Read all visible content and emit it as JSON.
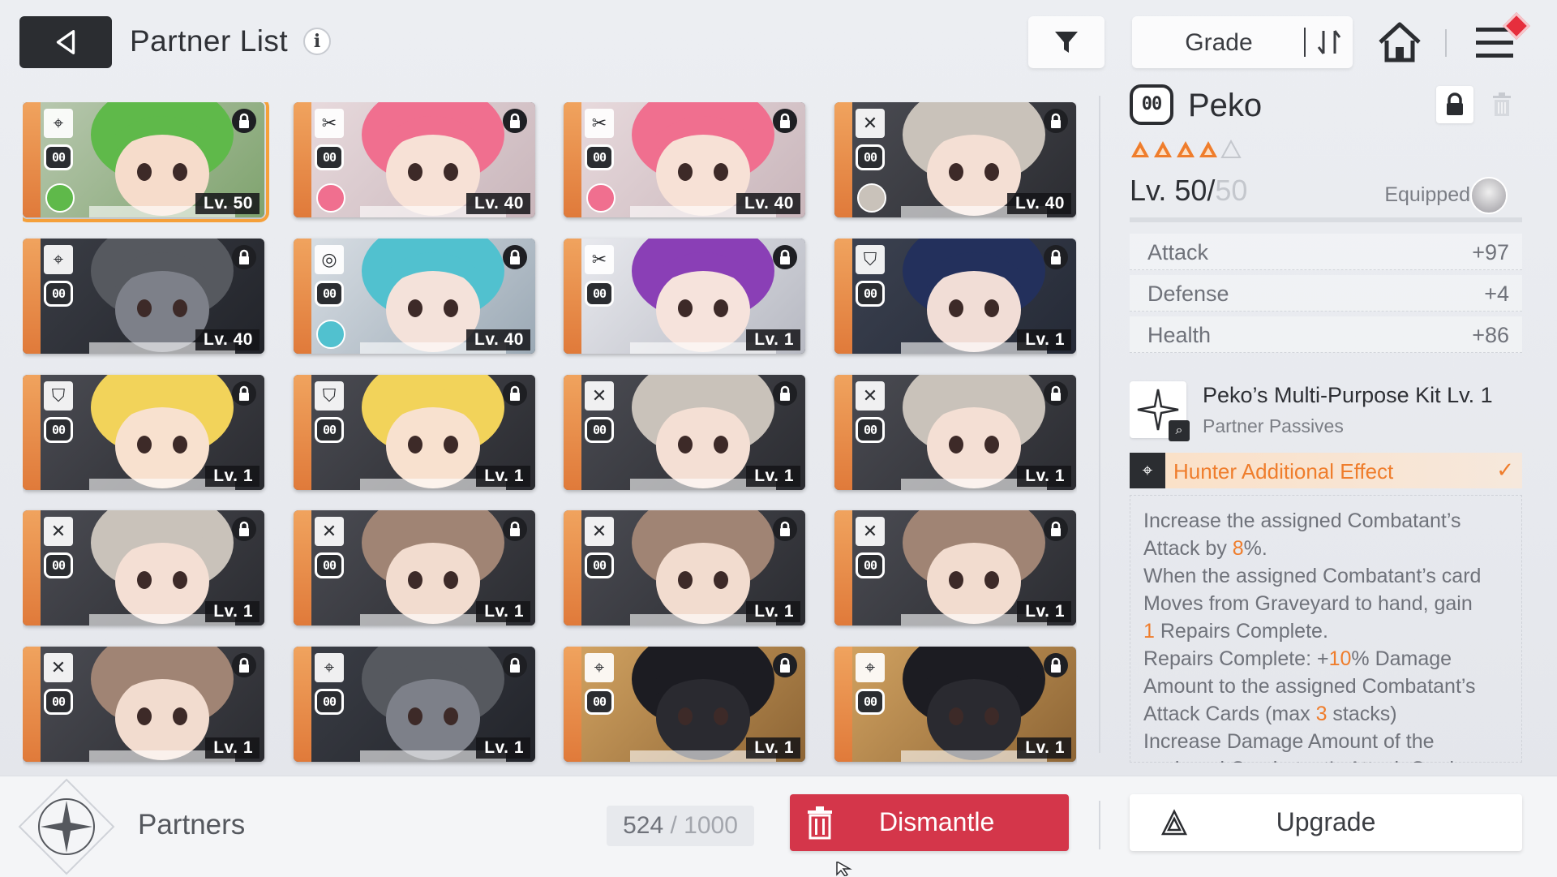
{
  "header": {
    "title": "Partner List",
    "info_icon": "info-icon",
    "back_icon": "back-arrow-icon",
    "filter_icon": "filter-icon",
    "sort_label": "Grade",
    "sort_order_icon": "sort-order-icon",
    "home_icon": "home-icon",
    "menu_icon": "menu-icon"
  },
  "cards": [
    {
      "level": "Lv. 50",
      "cls": "⌖",
      "theme": "green",
      "avatar": true,
      "selected": true
    },
    {
      "level": "Lv. 40",
      "cls": "✂",
      "theme": "pink",
      "avatar": true
    },
    {
      "level": "Lv. 40",
      "cls": "✂",
      "theme": "pink",
      "avatar": true
    },
    {
      "level": "Lv. 40",
      "cls": "✕",
      "theme": "silver",
      "avatar": true
    },
    {
      "level": "Lv. 40",
      "cls": "⌖",
      "theme": "mech",
      "avatar": false
    },
    {
      "level": "Lv. 40",
      "cls": "◎",
      "theme": "teal",
      "avatar": true
    },
    {
      "level": "Lv. 1",
      "cls": "✂",
      "theme": "purple",
      "avatar": false
    },
    {
      "level": "Lv. 1",
      "cls": "⛉",
      "theme": "navy",
      "avatar": false
    },
    {
      "level": "Lv. 1",
      "cls": "⛉",
      "theme": "blonde",
      "avatar": false
    },
    {
      "level": "Lv. 1",
      "cls": "⛉",
      "theme": "blonde",
      "avatar": false
    },
    {
      "level": "Lv. 1",
      "cls": "✕",
      "theme": "silver",
      "avatar": false
    },
    {
      "level": "Lv. 1",
      "cls": "✕",
      "theme": "silver",
      "avatar": false
    },
    {
      "level": "Lv. 1",
      "cls": "✕",
      "theme": "silver",
      "avatar": false
    },
    {
      "level": "Lv. 1",
      "cls": "✕",
      "theme": "brown",
      "avatar": false
    },
    {
      "level": "Lv. 1",
      "cls": "✕",
      "theme": "brown",
      "avatar": false
    },
    {
      "level": "Lv. 1",
      "cls": "✕",
      "theme": "brown",
      "avatar": false
    },
    {
      "level": "Lv. 1",
      "cls": "✕",
      "theme": "brown",
      "avatar": false
    },
    {
      "level": "Lv. 1",
      "cls": "⌖",
      "theme": "mech",
      "avatar": false
    },
    {
      "level": "Lv. 1",
      "cls": "⌖",
      "theme": "critter",
      "avatar": false
    },
    {
      "level": "Lv. 1",
      "cls": "⌖",
      "theme": "critter",
      "avatar": false
    }
  ],
  "card_rank_text": "00",
  "detail": {
    "name": "Peko",
    "rank_text": "00",
    "stars_filled": 4,
    "stars_total": 5,
    "level_label": "Lv. 50/",
    "level_max": "50",
    "equipped_label": "Equipped",
    "stats": [
      {
        "label": "Attack",
        "value": "+97"
      },
      {
        "label": "Defense",
        "value": "+4"
      },
      {
        "label": "Health",
        "value": "+86"
      }
    ],
    "passive_title": "Peko’s Multi-Purpose Kit Lv. 1",
    "passive_subtitle": "Partner Passives",
    "effect_label": "Hunter Additional Effect",
    "desc": {
      "l1": "Increase the assigned Combatant’s",
      "l2a": "Attack by ",
      "l2b": "8",
      "l2c": "%.",
      "l3": "When the assigned Combatant’s card",
      "l4": "Moves from Graveyard to hand, gain",
      "l5a": "1",
      "l5b": " Repairs Complete.",
      "l6a": "Repairs Complete: +",
      "l6b": "10",
      "l6c": "% Damage",
      "l7": "Amount to the assigned Combatant’s",
      "l8a": "Attack Cards (max ",
      "l8b": "3",
      "l8c": " stacks)",
      "l9": "Increase Damage Amount of the",
      "l10": "assigned Combatant’s Attack Cards"
    }
  },
  "footer": {
    "label": "Partners",
    "count": "524",
    "count_sep": " / ",
    "capacity": "1000",
    "dismantle_label": "Dismantle",
    "upgrade_label": "Upgrade"
  },
  "colors": {
    "accent_orange": "#ef7d2c",
    "dismantle_red": "#d4364a",
    "selected_outline": "#f5a03a"
  }
}
